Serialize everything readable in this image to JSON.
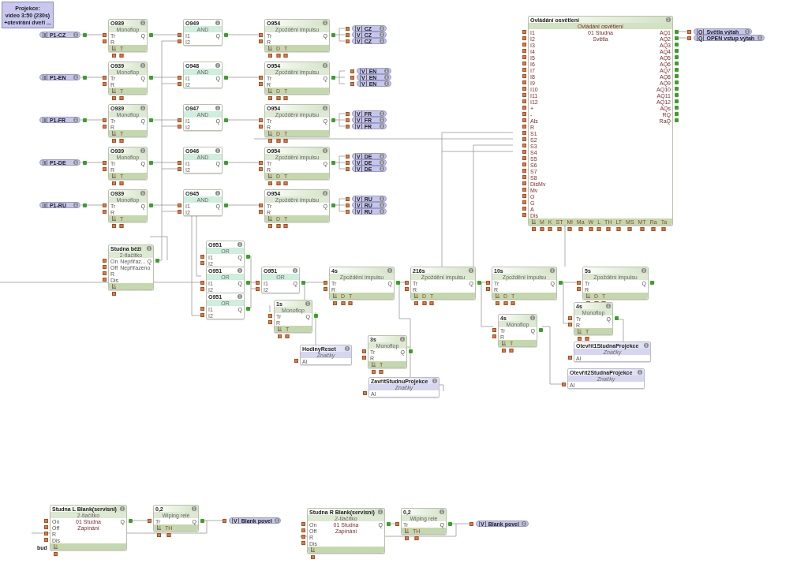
{
  "note": {
    "lines": [
      "Projekce:",
      "video 3:50 (230s)",
      "+otevírání dveří ..."
    ]
  },
  "blocks": [
    {
      "kind": "function",
      "title": "O939",
      "type": "Monoflop",
      "inputs": [
        "Tr",
        "R"
      ],
      "outputs": [
        "Q"
      ],
      "toolbar": true,
      "params": [
        "T"
      ]
    },
    {
      "kind": "function",
      "title": "O939",
      "type": "Monoflop",
      "inputs": [
        "Tr",
        "R"
      ],
      "outputs": [
        "Q"
      ],
      "toolbar": true,
      "params": [
        "T"
      ]
    },
    {
      "kind": "function",
      "title": "O939",
      "type": "Monoflop",
      "inputs": [
        "Tr",
        "R"
      ],
      "outputs": [
        "Q"
      ],
      "toolbar": true,
      "params": [
        "T"
      ]
    },
    {
      "kind": "function",
      "title": "O939",
      "type": "Monoflop",
      "inputs": [
        "Tr",
        "R"
      ],
      "outputs": [
        "Q"
      ],
      "toolbar": true,
      "params": [
        "T"
      ]
    },
    {
      "kind": "function",
      "title": "O939",
      "type": "Monoflop",
      "inputs": [
        "Tr",
        "R"
      ],
      "outputs": [
        "Q"
      ],
      "toolbar": true,
      "params": [
        "T"
      ]
    },
    {
      "kind": "gate",
      "title": "O949",
      "type": "AND",
      "inputs": [
        "I1",
        "I2"
      ],
      "outputs": [
        "Q"
      ]
    },
    {
      "kind": "gate",
      "title": "O948",
      "type": "AND",
      "inputs": [
        "I1",
        "I2"
      ],
      "outputs": [
        "Q"
      ]
    },
    {
      "kind": "gate",
      "title": "O947",
      "type": "AND",
      "inputs": [
        "I1",
        "I2"
      ],
      "outputs": [
        "Q"
      ]
    },
    {
      "kind": "gate",
      "title": "O946",
      "type": "AND",
      "inputs": [
        "I1",
        "I2"
      ],
      "outputs": [
        "Q"
      ]
    },
    {
      "kind": "gate",
      "title": "O945",
      "type": "AND",
      "inputs": [
        "I1",
        "I2"
      ],
      "outputs": [
        "Q"
      ]
    },
    {
      "kind": "function",
      "title": "O954",
      "type": "Zpoždění impulsu",
      "inputs": [
        "Tr",
        "R"
      ],
      "outputs": [
        "Q"
      ],
      "toolbar": true,
      "params": [
        "D",
        "T"
      ]
    },
    {
      "kind": "function",
      "title": "O954",
      "type": "Zpoždění impulsu",
      "inputs": [
        "Tr",
        "R"
      ],
      "outputs": [
        "Q"
      ],
      "toolbar": true,
      "params": [
        "D",
        "T"
      ]
    },
    {
      "kind": "function",
      "title": "O954",
      "type": "Zpoždění impulsu",
      "inputs": [
        "Tr",
        "R"
      ],
      "outputs": [
        "Q"
      ],
      "toolbar": true,
      "params": [
        "D",
        "T"
      ]
    },
    {
      "kind": "function",
      "title": "O954",
      "type": "Zpoždění impulsu",
      "inputs": [
        "Tr",
        "R"
      ],
      "outputs": [
        "Q"
      ],
      "toolbar": true,
      "params": [
        "D",
        "T"
      ]
    },
    {
      "kind": "function",
      "title": "O954",
      "type": "Zpoždění impulsu",
      "inputs": [
        "Tr",
        "R"
      ],
      "outputs": [
        "Q"
      ],
      "toolbar": true,
      "params": [
        "D",
        "T"
      ]
    },
    {
      "kind": "program",
      "title": "Ovládání osvětlení",
      "type": "Ovládání osvětlení",
      "inputs": [
        "I1",
        "I2",
        "I3",
        "I4",
        "I5",
        "I6",
        "I7",
        "I8",
        "I9",
        "I10",
        "I11",
        "I12",
        "+",
        "-",
        "Als",
        "R",
        "S1",
        "S2",
        "S3",
        "S4",
        "S5",
        "S6",
        "S7",
        "S8",
        "DisMv",
        "Mv",
        "O",
        "G",
        "A",
        "Dis"
      ],
      "description": [
        "01 Studna",
        "Světla"
      ],
      "outputs": [
        "AQ1",
        "AQ2",
        "AQ3",
        "AQ4",
        "AQ5",
        "AQ6",
        "AQ7",
        "AQ8",
        "AQ9",
        "AQ10",
        "AQ11",
        "AQ12",
        "AQs",
        "RQ",
        "RaQ"
      ],
      "toolbar": true,
      "params": [
        "M",
        "K",
        "ST",
        "Ml",
        "Ma",
        "W",
        "L",
        "TH",
        "LT",
        "MS",
        "MT",
        "Ra",
        "Ta"
      ]
    },
    {
      "kind": "function",
      "title": "Studna běží",
      "type": "2-tlačítko",
      "inputs": [
        "On",
        "Off",
        "R",
        "Dis"
      ],
      "input_notes": [
        "Nepřiřaz...",
        "Nepřiřazeno"
      ],
      "outputs": [
        "Q"
      ],
      "toolbar": true
    },
    {
      "kind": "gate",
      "title": "O951",
      "type": "OR",
      "inputs": [
        "I1",
        "I2"
      ],
      "outputs": [
        "Q"
      ]
    },
    {
      "kind": "gate",
      "title": "O951",
      "type": "OR",
      "inputs": [
        "I1",
        "I2"
      ],
      "outputs": [
        "Q"
      ]
    },
    {
      "kind": "gate",
      "title": "O951",
      "type": "OR",
      "inputs": [
        "I1",
        "I2"
      ],
      "outputs": [
        "Q"
      ]
    },
    {
      "kind": "gate",
      "title": "O951",
      "type": "OR",
      "inputs": [
        "I1",
        "I2"
      ],
      "outputs": [
        "Q"
      ]
    },
    {
      "kind": "function",
      "title": "4s",
      "type": "Zpoždění impulsu",
      "inputs": [
        "Tr",
        "R"
      ],
      "outputs": [
        "Q"
      ],
      "toolbar": true,
      "params": [
        "D",
        "T"
      ]
    },
    {
      "kind": "function",
      "title": "216s",
      "type": "Zpoždění impulsu",
      "inputs": [
        "Tr",
        "R"
      ],
      "outputs": [
        "Q"
      ],
      "toolbar": true,
      "params": [
        "D",
        "T"
      ]
    },
    {
      "kind": "function",
      "title": "10s",
      "type": "Zpoždění impulsu",
      "inputs": [
        "Tr",
        "R"
      ],
      "outputs": [
        "Q"
      ],
      "toolbar": true,
      "params": [
        "D",
        "T"
      ]
    },
    {
      "kind": "function",
      "title": "5s",
      "type": "Zpoždění impulsu",
      "inputs": [
        "Tr",
        "R"
      ],
      "outputs": [
        "Q"
      ],
      "toolbar": true,
      "params": [
        "D",
        "T"
      ]
    },
    {
      "kind": "function",
      "title": "1s",
      "type": "Monoflop",
      "inputs": [
        "Tr",
        "R"
      ],
      "outputs": [
        "Q"
      ],
      "toolbar": true,
      "params": [
        "T"
      ]
    },
    {
      "kind": "function",
      "title": "3s",
      "type": "Monoflop",
      "inputs": [
        "Tr",
        "R"
      ],
      "outputs": [
        "Q"
      ],
      "toolbar": true,
      "params": [
        "T"
      ]
    },
    {
      "kind": "function",
      "title": "4s",
      "type": "Monoflop",
      "inputs": [
        "Tr",
        "R"
      ],
      "outputs": [
        "Q"
      ],
      "toolbar": true,
      "params": [
        "T"
      ]
    },
    {
      "kind": "function",
      "title": "4s",
      "type": "Monoflop",
      "inputs": [
        "Tr",
        "R"
      ],
      "outputs": [
        "Q"
      ],
      "toolbar": true,
      "params": [
        "T"
      ]
    },
    {
      "kind": "marker",
      "title": "HodinyReset",
      "type": "Značky",
      "inputs": [
        "AI"
      ]
    },
    {
      "kind": "marker",
      "title": "ZavřítStudnuProjekce",
      "type": "Značky",
      "inputs": [
        "AI"
      ]
    },
    {
      "kind": "marker",
      "title": "Otevřít1StudnaProjekce",
      "type": "Značky",
      "inputs": [
        "AI"
      ]
    },
    {
      "kind": "marker",
      "title": "Otevřít2StudnaProjekce",
      "type": "Značky",
      "inputs": [
        "AI"
      ]
    },
    {
      "kind": "function",
      "title": "Studna L Blank(servisní)",
      "type": "2-tlačítko",
      "inputs": [
        "On",
        "Off",
        "R",
        "Dis"
      ],
      "description": [
        "01 Studna",
        "Zapínání"
      ],
      "outputs": [
        "Q"
      ],
      "toolbar": true
    },
    {
      "kind": "function",
      "title": "0,2",
      "type": "Wiping relé",
      "inputs": [
        "Tr"
      ],
      "outputs": [
        "Q"
      ],
      "toolbar": true,
      "params": [
        "TH"
      ]
    },
    {
      "kind": "function",
      "title": "Studna R Blank(servisní)",
      "type": "2-tlačítko",
      "inputs": [
        "On",
        "Off",
        "R",
        "Dis"
      ],
      "description": [
        "01 Studna",
        "Zapínání"
      ],
      "outputs": [
        "Q"
      ],
      "toolbar": true
    },
    {
      "kind": "function",
      "title": "0,2",
      "type": "Wiping relé",
      "inputs": [
        "Tr"
      ],
      "outputs": [
        "Q"
      ],
      "toolbar": true,
      "params": [
        "TH"
      ]
    }
  ],
  "io": [
    {
      "kind": "input",
      "prefix": "I",
      "label": "P1-CZ"
    },
    {
      "kind": "input",
      "prefix": "I",
      "label": "P1-EN"
    },
    {
      "kind": "input",
      "prefix": "I",
      "label": "P1-FR"
    },
    {
      "kind": "input",
      "prefix": "I",
      "label": "P1-DE"
    },
    {
      "kind": "input",
      "prefix": "I",
      "label": "P1-RU"
    },
    {
      "kind": "output",
      "prefix": "V",
      "label": "CZ"
    },
    {
      "kind": "output",
      "prefix": "V",
      "label": "CZ"
    },
    {
      "kind": "output",
      "prefix": "V",
      "label": "CZ"
    },
    {
      "kind": "output",
      "prefix": "V",
      "label": "EN"
    },
    {
      "kind": "output",
      "prefix": "V",
      "label": "EN"
    },
    {
      "kind": "output",
      "prefix": "V",
      "label": "EN"
    },
    {
      "kind": "output",
      "prefix": "V",
      "label": "FR"
    },
    {
      "kind": "output",
      "prefix": "V",
      "label": "FR"
    },
    {
      "kind": "output",
      "prefix": "V",
      "label": "FR"
    },
    {
      "kind": "output",
      "prefix": "V",
      "label": "DE"
    },
    {
      "kind": "output",
      "prefix": "V",
      "label": "DE"
    },
    {
      "kind": "output",
      "prefix": "V",
      "label": "DE"
    },
    {
      "kind": "output",
      "prefix": "V",
      "label": "RU"
    },
    {
      "kind": "output",
      "prefix": "V",
      "label": "RU"
    },
    {
      "kind": "output",
      "prefix": "V",
      "label": "RU"
    },
    {
      "kind": "output",
      "prefix": "Q",
      "label": "Světla výtah"
    },
    {
      "kind": "output",
      "prefix": "Q",
      "label": "OPEN vstup výtah"
    },
    {
      "kind": "output",
      "prefix": "V",
      "label": "Blank povel"
    },
    {
      "kind": "output",
      "prefix": "V",
      "label": "Blank povel"
    }
  ],
  "stray_label": "bud"
}
